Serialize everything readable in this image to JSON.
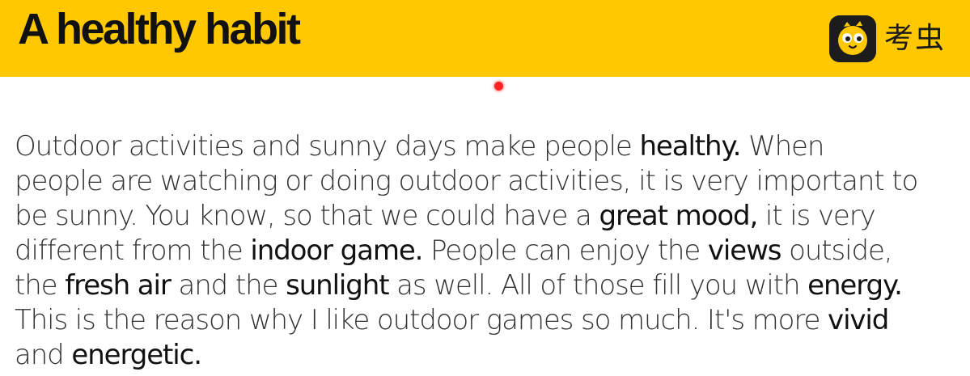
{
  "header": {
    "title": "A healthy habit",
    "brand_name": "考虫",
    "brand_icon": "koochong-chick-logo-icon",
    "background_color": "#FFC800"
  },
  "marker": {
    "icon": "red-dot",
    "color": "#FF2222"
  },
  "paragraph": {
    "lines": [
      [
        {
          "text": "Outdoor activities and sunny days make people ",
          "emphasis": false
        },
        {
          "text": "healthy.",
          "emphasis": true
        },
        {
          "text": " When",
          "emphasis": false
        }
      ],
      [
        {
          "text": "people are watching or doing outdoor activities, it is very important to",
          "emphasis": false
        }
      ],
      [
        {
          "text": "be sunny. You know, so that we could have a ",
          "emphasis": false
        },
        {
          "text": "great mood,",
          "emphasis": true
        },
        {
          "text": " it is very",
          "emphasis": false
        }
      ],
      [
        {
          "text": "different from the ",
          "emphasis": false
        },
        {
          "text": "indoor game.",
          "emphasis": true
        },
        {
          "text": " People can enjoy the ",
          "emphasis": false
        },
        {
          "text": "views",
          "emphasis": true
        },
        {
          "text": " outside,",
          "emphasis": false
        }
      ],
      [
        {
          "text": "the ",
          "emphasis": false
        },
        {
          "text": "fresh air",
          "emphasis": true
        },
        {
          "text": " and the ",
          "emphasis": false
        },
        {
          "text": "sunlight",
          "emphasis": true
        },
        {
          "text": " as well. All of those fill you with ",
          "emphasis": false
        },
        {
          "text": "energy.",
          "emphasis": true
        }
      ],
      [
        {
          "text": "This is the reason why I like outdoor games so much. It's more ",
          "emphasis": false
        },
        {
          "text": "vivid",
          "emphasis": true
        }
      ],
      [
        {
          "text": "and ",
          "emphasis": false
        },
        {
          "text": "energetic.",
          "emphasis": true
        }
      ]
    ]
  }
}
